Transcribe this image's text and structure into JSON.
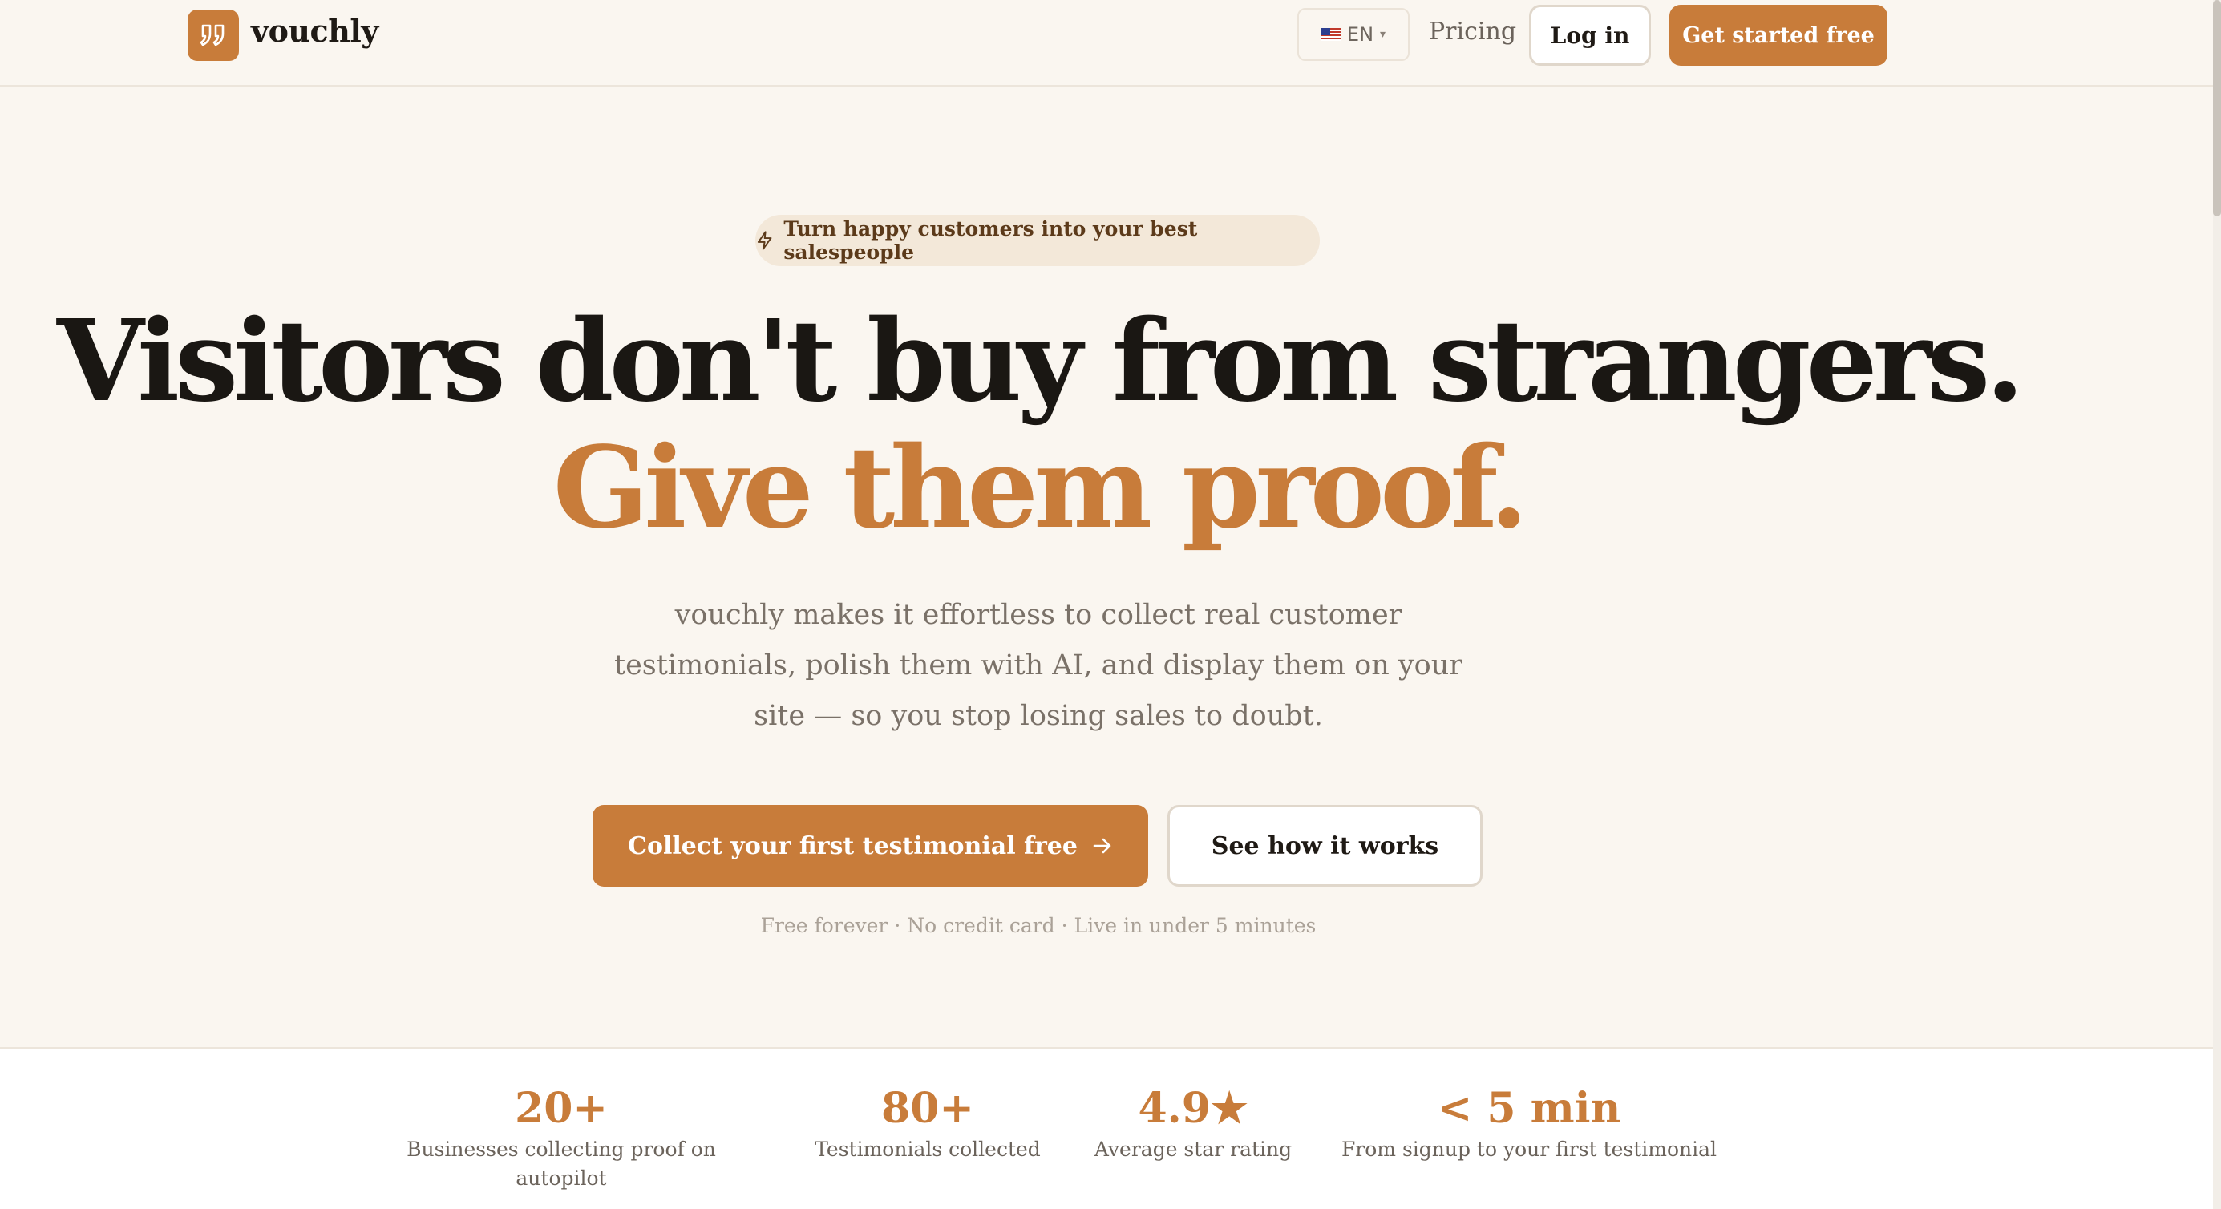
{
  "nav": {
    "brand": "vouchly",
    "language": "EN",
    "pricing": "Pricing",
    "login": "Log in",
    "get_started": "Get started free"
  },
  "hero": {
    "badge": "Turn happy customers into your best salespeople",
    "headline": "Visitors don't buy from strangers.",
    "headline_accent": "Give them proof.",
    "subheadline": "vouchly makes it effortless to collect real customer testimonials, polish them with AI, and display them on your site — so you stop losing sales to doubt.",
    "cta_primary": "Collect your first testimonial free",
    "cta_secondary": "See how it works",
    "fineprint": "Free forever · No credit card · Live in under 5 minutes"
  },
  "stats": [
    {
      "value": "20+",
      "label": "Businesses collecting proof on autopilot"
    },
    {
      "value": "80+",
      "label": "Testimonials collected"
    },
    {
      "value": "4.9★",
      "label": "Average star rating"
    },
    {
      "value": "< 5 min",
      "label": "From signup to your first testimonial"
    }
  ],
  "colors": {
    "accent": "#c87c3a",
    "background": "#faf6f0",
    "text": "#1a1713"
  }
}
